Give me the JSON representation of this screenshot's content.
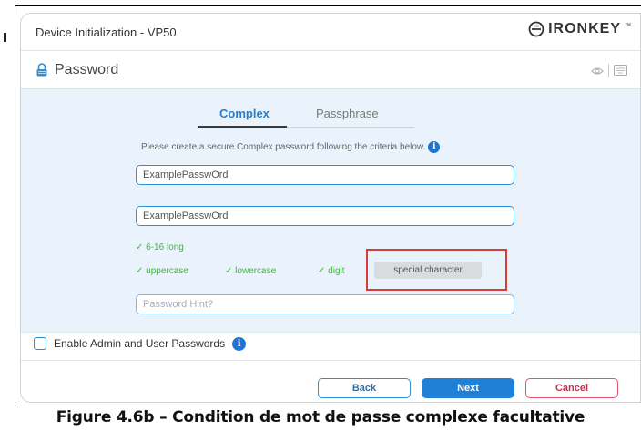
{
  "window": {
    "title": "Device Initialization - VP50",
    "brand": "IRONKEY",
    "brand_mark": "™"
  },
  "section": {
    "title": "Password",
    "icon": "lock-icon",
    "toolbar_icons": [
      "eye-icon",
      "keyboard-icon"
    ]
  },
  "tabs": [
    {
      "label": "Complex",
      "active": true
    },
    {
      "label": "Passphrase",
      "active": false
    }
  ],
  "instructions": "Please create a secure Complex password following the criteria below.",
  "fields": {
    "password_value": "ExamplePasswOrd",
    "confirm_value": "ExamplePasswOrd",
    "hint_placeholder": "Password Hint?"
  },
  "criteria": {
    "length": "✓ 6-16 long",
    "uppercase": "✓ uppercase",
    "lowercase": "✓ lowercase",
    "digit": "✓ digit",
    "special": "special character"
  },
  "options": {
    "enable_admin_user": "Enable Admin and User Passwords",
    "checked": false
  },
  "buttons": {
    "back": "Back",
    "next": "Next",
    "cancel": "Cancel"
  },
  "caption": "Figure 4.6b – Condition de mot de passe complexe facultative",
  "colors": {
    "accent": "#1f80d6",
    "success": "#3fb83f",
    "highlight": "#d93a3a",
    "cancel": "#e0546c",
    "content_bg": "#eaf3fb"
  }
}
